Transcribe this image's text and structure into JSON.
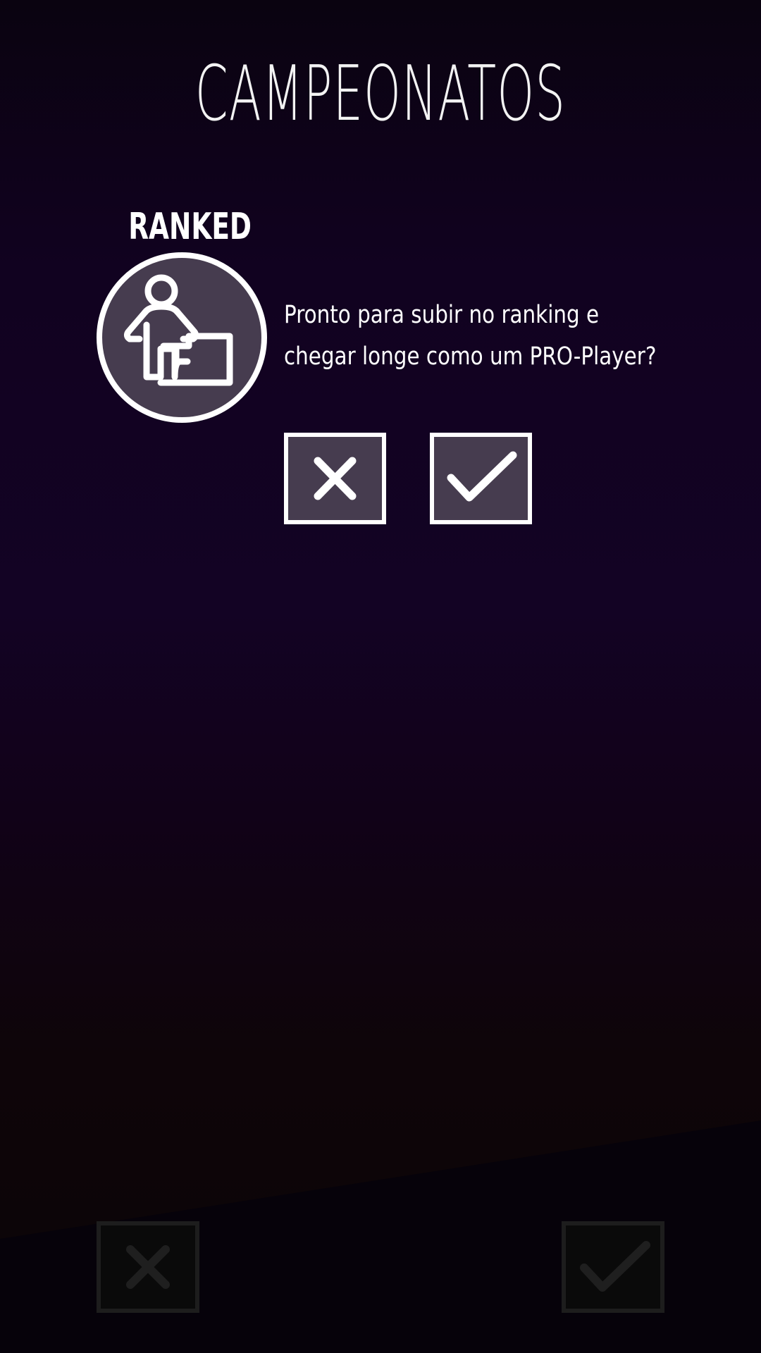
{
  "header": {
    "title": "CAMPEONATOS"
  },
  "ranked_card": {
    "label": "RANKED",
    "icon": "player-podium-icon",
    "description": "Pronto para subir no ranking e chegar longe como um PRO-Player?",
    "reject_icon": "close-icon",
    "accept_icon": "check-icon"
  },
  "footer": {
    "reject_icon": "close-icon",
    "accept_icon": "check-icon"
  },
  "colors": {
    "button_fill": "#463c4f",
    "button_border": "#ffffff",
    "footer_button_border": "#1d1d1d",
    "text": "#ffffff"
  }
}
